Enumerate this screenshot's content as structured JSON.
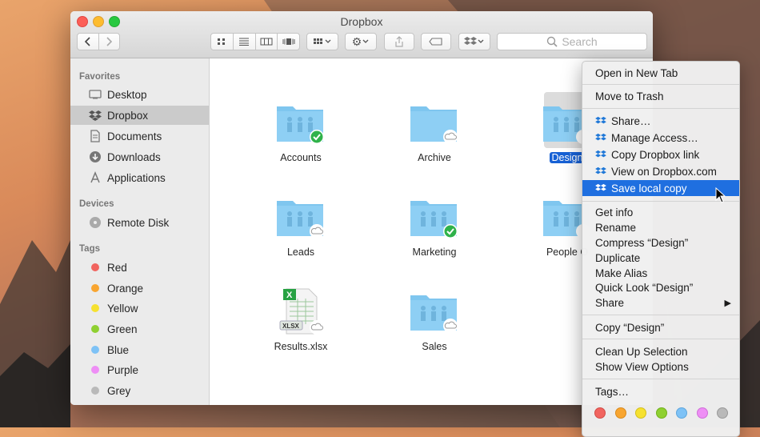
{
  "window": {
    "title": "Dropbox"
  },
  "search": {
    "placeholder": "Search"
  },
  "sidebar": {
    "favorites_header": "Favorites",
    "favorites": [
      {
        "label": "Desktop",
        "icon": "desktop-icon"
      },
      {
        "label": "Dropbox",
        "icon": "dropbox-icon",
        "selected": true
      },
      {
        "label": "Documents",
        "icon": "documents-icon"
      },
      {
        "label": "Downloads",
        "icon": "downloads-icon"
      },
      {
        "label": "Applications",
        "icon": "applications-icon"
      }
    ],
    "devices_header": "Devices",
    "devices": [
      {
        "label": "Remote Disk",
        "icon": "disk-icon"
      }
    ],
    "tags_header": "Tags",
    "tags": [
      {
        "label": "Red",
        "color": "#f1645f"
      },
      {
        "label": "Orange",
        "color": "#f8a530"
      },
      {
        "label": "Yellow",
        "color": "#f6e130"
      },
      {
        "label": "Green",
        "color": "#8fd031"
      },
      {
        "label": "Blue",
        "color": "#7ec2f6"
      },
      {
        "label": "Purple",
        "color": "#ee8ef5"
      },
      {
        "label": "Grey",
        "color": "#b9b9b9"
      }
    ]
  },
  "files": [
    {
      "name": "Accounts",
      "type": "folder",
      "status": "synced"
    },
    {
      "name": "Archive",
      "type": "folder",
      "status": "online-only"
    },
    {
      "name": "Design",
      "type": "folder",
      "status": "online-only",
      "selected": true
    },
    {
      "name": "Leads",
      "type": "folder",
      "status": "online-only"
    },
    {
      "name": "Marketing",
      "type": "folder",
      "status": "synced"
    },
    {
      "name": "People O",
      "type": "folder",
      "status": "online-only"
    },
    {
      "name": "Results.xlsx",
      "type": "xlsx",
      "status": "online-only",
      "badge": "XLSX"
    },
    {
      "name": "Sales",
      "type": "folder",
      "status": "online-only"
    }
  ],
  "context_menu": {
    "items": [
      "Open in New Tab",
      "Move to Trash",
      "Share…",
      "Manage Access…",
      "Copy Dropbox link",
      "View on Dropbox.com",
      "Save local copy",
      "Get info",
      "Rename",
      "Compress “Design”",
      "Duplicate",
      "Make Alias",
      "Quick Look “Design”",
      "Share",
      "Copy “Design”",
      "Clean Up Selection",
      "Show View Options",
      "Tags…"
    ],
    "highlighted": "Save local copy",
    "tag_colors": [
      "#f1645f",
      "#f8a530",
      "#f6e130",
      "#8fd031",
      "#7ec2f6",
      "#ee8ef5",
      "#b9b9b9"
    ]
  },
  "colors": {
    "accent": "#1f6fe0",
    "folder": "#8ecff4",
    "synced": "#2fb24a"
  }
}
